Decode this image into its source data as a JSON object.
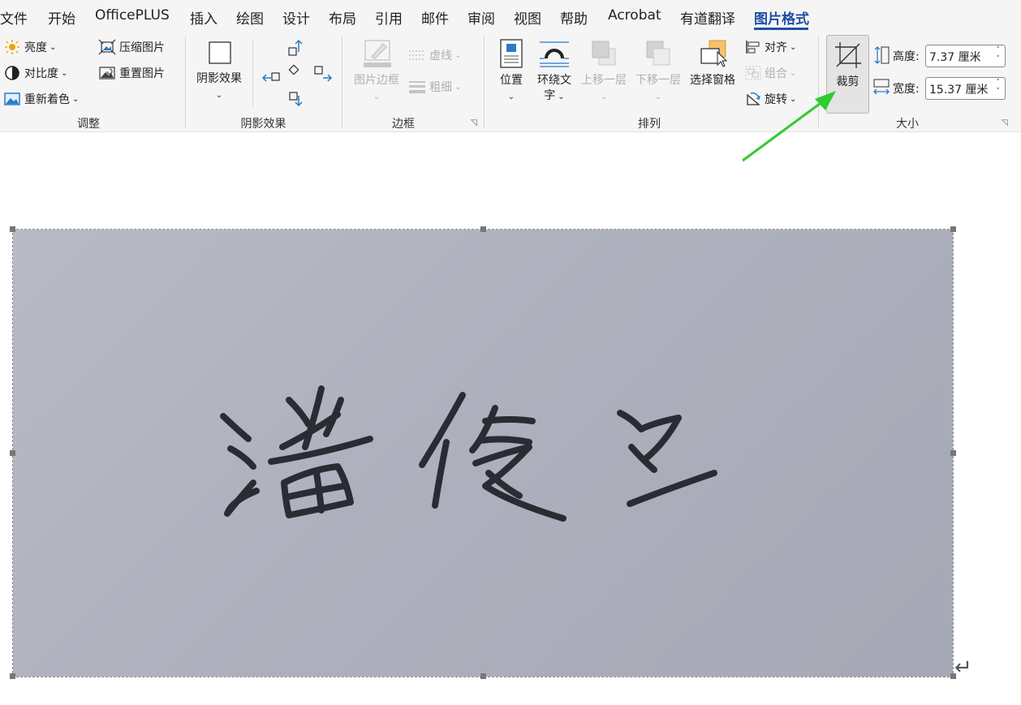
{
  "tabs": [
    "文件",
    "开始",
    "OfficePLUS",
    "插入",
    "绘图",
    "设计",
    "布局",
    "引用",
    "邮件",
    "审阅",
    "视图",
    "帮助",
    "Acrobat",
    "有道翻译",
    "图片格式"
  ],
  "active_tab": "图片格式",
  "ribbon": {
    "adjust": {
      "brightness": "亮度",
      "contrast": "对比度",
      "recolor": "重新着色",
      "compress": "压缩图片",
      "reset": "重置图片",
      "group_label": "调整"
    },
    "shadow": {
      "shadow_effect": "阴影效果",
      "group_label": "阴影效果"
    },
    "border": {
      "picture_border": "图片边框",
      "dashes": "虚线",
      "weight": "粗细",
      "group_label": "边框"
    },
    "arrange": {
      "position": "位置",
      "wrap_text_line1": "环绕文",
      "wrap_text_line2": "字",
      "bring_forward": "上移一层",
      "send_backward": "下移一层",
      "selection_pane": "选择窗格",
      "align": "对齐",
      "group": "组合",
      "rotate": "旋转",
      "group_label": "排列"
    },
    "size": {
      "crop": "裁剪",
      "height_label": "高度:",
      "height_value": "7.37 厘米",
      "width_label": "宽度:",
      "width_value": "15.37 厘米",
      "group_label": "大小"
    }
  },
  "icons": {
    "crop": "crop-icon",
    "annotation": "green-arrow-annotation"
  },
  "colors": {
    "accent": "#1f4fa5",
    "annotation_arrow": "#2ecc2e",
    "ribbon_bg": "#f5f5f5"
  },
  "document": {
    "image_content": "handwritten-signature"
  }
}
